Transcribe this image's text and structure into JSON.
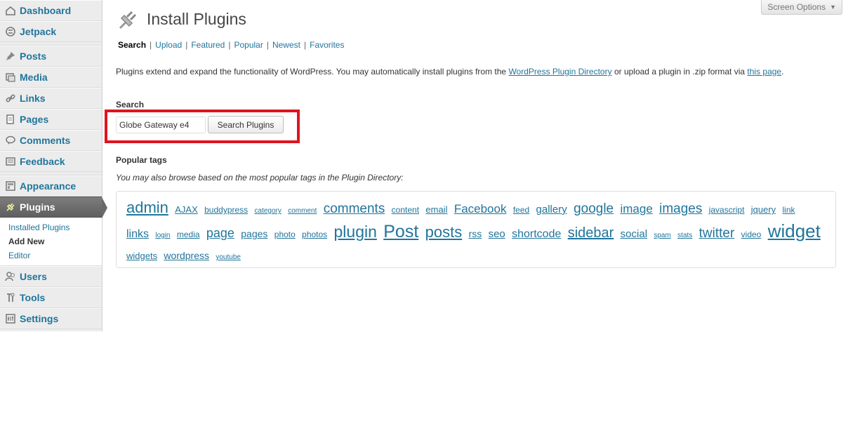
{
  "sidebar": {
    "items": [
      {
        "label": "Dashboard",
        "icon": "dashboard-icon"
      },
      {
        "label": "Jetpack",
        "icon": "jetpack-icon"
      },
      {
        "label": "Posts",
        "icon": "pin-icon"
      },
      {
        "label": "Media",
        "icon": "media-icon"
      },
      {
        "label": "Links",
        "icon": "link-icon"
      },
      {
        "label": "Pages",
        "icon": "pages-icon"
      },
      {
        "label": "Comments",
        "icon": "comment-icon"
      },
      {
        "label": "Feedback",
        "icon": "feedback-icon"
      },
      {
        "label": "Appearance",
        "icon": "appearance-icon"
      },
      {
        "label": "Plugins",
        "icon": "plugin-icon"
      },
      {
        "label": "Users",
        "icon": "users-icon"
      },
      {
        "label": "Tools",
        "icon": "tools-icon"
      },
      {
        "label": "Settings",
        "icon": "settings-icon"
      }
    ],
    "plugins_submenu": [
      "Installed Plugins",
      "Add New",
      "Editor"
    ]
  },
  "screen_options": "Screen Options",
  "page_title": "Install Plugins",
  "tabs": [
    "Search",
    "Upload",
    "Featured",
    "Popular",
    "Newest",
    "Favorites"
  ],
  "intro": {
    "part1": "Plugins extend and expand the functionality of WordPress. You may automatically install plugins from the ",
    "link1": "WordPress Plugin Directory",
    "part2": " or upload a plugin in .zip format via ",
    "link2": "this page",
    "part3": "."
  },
  "search": {
    "heading": "Search",
    "value": "Globe Gateway e4",
    "button": "Search Plugins"
  },
  "popular_tags": {
    "heading": "Popular tags",
    "note": "You may also browse based on the most popular tags in the Plugin Directory:",
    "tags": [
      {
        "t": "admin",
        "s": 22
      },
      {
        "t": "AJAX",
        "s": 13
      },
      {
        "t": "buddypress",
        "s": 12
      },
      {
        "t": "category",
        "s": 10
      },
      {
        "t": "comment",
        "s": 10
      },
      {
        "t": "comments",
        "s": 19
      },
      {
        "t": "content",
        "s": 12
      },
      {
        "t": "email",
        "s": 13
      },
      {
        "t": "Facebook",
        "s": 17
      },
      {
        "t": "feed",
        "s": 12
      },
      {
        "t": "gallery",
        "s": 15
      },
      {
        "t": "google",
        "s": 19
      },
      {
        "t": "image",
        "s": 17
      },
      {
        "t": "images",
        "s": 19
      },
      {
        "t": "javascript",
        "s": 12
      },
      {
        "t": "jquery",
        "s": 13
      },
      {
        "t": "link",
        "s": 12
      },
      {
        "t": "links",
        "s": 16
      },
      {
        "t": "login",
        "s": 10
      },
      {
        "t": "media",
        "s": 12
      },
      {
        "t": "page",
        "s": 18
      },
      {
        "t": "pages",
        "s": 14
      },
      {
        "t": "photo",
        "s": 12
      },
      {
        "t": "photos",
        "s": 12
      },
      {
        "t": "plugin",
        "s": 23
      },
      {
        "t": "Post",
        "s": 25
      },
      {
        "t": "posts",
        "s": 22
      },
      {
        "t": "rss",
        "s": 14
      },
      {
        "t": "seo",
        "s": 15
      },
      {
        "t": "shortcode",
        "s": 16
      },
      {
        "t": "sidebar",
        "s": 20
      },
      {
        "t": "social",
        "s": 15
      },
      {
        "t": "spam",
        "s": 10
      },
      {
        "t": "stats",
        "s": 10
      },
      {
        "t": "twitter",
        "s": 19
      },
      {
        "t": "video",
        "s": 12
      },
      {
        "t": "widget",
        "s": 26
      },
      {
        "t": "widgets",
        "s": 13
      },
      {
        "t": "wordpress",
        "s": 14
      },
      {
        "t": "youtube",
        "s": 10
      }
    ]
  },
  "colors": {
    "link": "#21759b",
    "highlight": "#e0141e"
  }
}
